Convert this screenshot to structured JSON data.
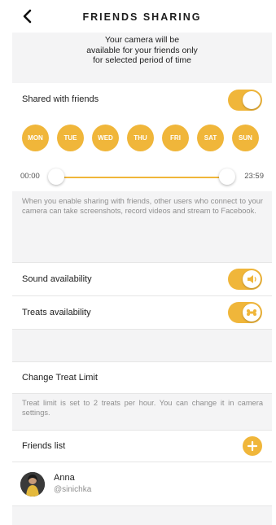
{
  "header": {
    "title": "FRIENDS SHARING",
    "back_icon": "chevron-left-icon"
  },
  "intro": {
    "lines": [
      "Your camera will be",
      "available for your friends only",
      "for selected period of time"
    ]
  },
  "sharing": {
    "label": "Shared with friends",
    "enabled": true
  },
  "days": [
    "MON",
    "TUE",
    "WED",
    "THU",
    "FRI",
    "SAT",
    "SUN"
  ],
  "time_range": {
    "start": "00:00",
    "end": "23:59"
  },
  "sharing_note": "When you enable sharing with friends, other users who connect to your camera can take screenshots, record videos and stream to Facebook.",
  "sound": {
    "label": "Sound availability",
    "enabled": true,
    "icon": "speaker-icon"
  },
  "treats": {
    "label": "Treats availability",
    "enabled": true,
    "icon": "bone-icon"
  },
  "treat_limit": {
    "label": "Change Treat Limit",
    "note": "Treat limit is set to 2 treats per hour. You can change it in camera settings."
  },
  "friends": {
    "label": "Friends list",
    "add_icon": "plus-icon",
    "items": [
      {
        "name": "Anna",
        "handle": "@sinichka"
      }
    ]
  },
  "colors": {
    "accent": "#f0b63a",
    "background": "#f4f4f5",
    "muted_text": "#8e8e8e"
  }
}
